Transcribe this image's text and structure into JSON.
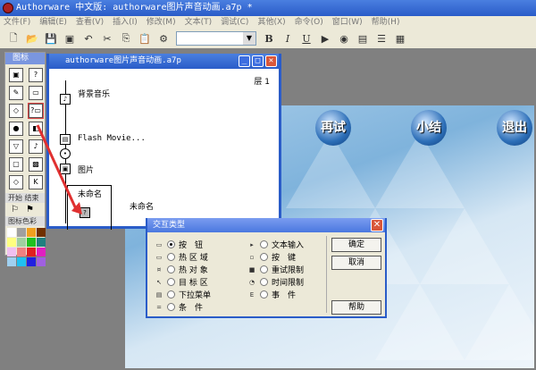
{
  "title": "Authorware 中文版: authorware图片声音动画.a7p *",
  "menu": [
    "文件(F)",
    "编辑(E)",
    "查看(V)",
    "插入(I)",
    "修改(M)",
    "文本(T)",
    "调试(C)",
    "其他(X)",
    "命令(O)",
    "窗口(W)",
    "帮助(H)"
  ],
  "toolbar": {
    "bold": "B",
    "italic": "I",
    "underline": "U"
  },
  "palette": {
    "title": "图标",
    "start_end": "开始 结束",
    "colors_label": "图标色彩",
    "colors": [
      "#ffffff",
      "#a0a0a0",
      "#f0a020",
      "#703000",
      "#ffff80",
      "#a0d0a0",
      "#20c020",
      "#208080",
      "#f0c0f0",
      "#f08080",
      "#e02020",
      "#e020c0",
      "#a0d0f0",
      "#20c0f0",
      "#2020e0",
      "#a060e0"
    ]
  },
  "flow": {
    "title": "authorware图片声音动画.a7p",
    "level": "层 1",
    "items": [
      "背景音乐",
      "Flash Movie...",
      "图片",
      "未命名",
      "未命名"
    ]
  },
  "stage": {
    "buttons": [
      "再试",
      "小结",
      "退出"
    ]
  },
  "dialog": {
    "title": "交互类型",
    "left_options": [
      "按　钮",
      "热 区 域",
      "热 对 象",
      "目 标 区",
      "下拉菜单",
      "条　件"
    ],
    "right_options": [
      "文本输入",
      "按　键",
      "重试限制",
      "时间限制",
      "事　件"
    ],
    "selected": "按　钮",
    "ok": "确定",
    "cancel": "取消",
    "help": "帮助"
  }
}
